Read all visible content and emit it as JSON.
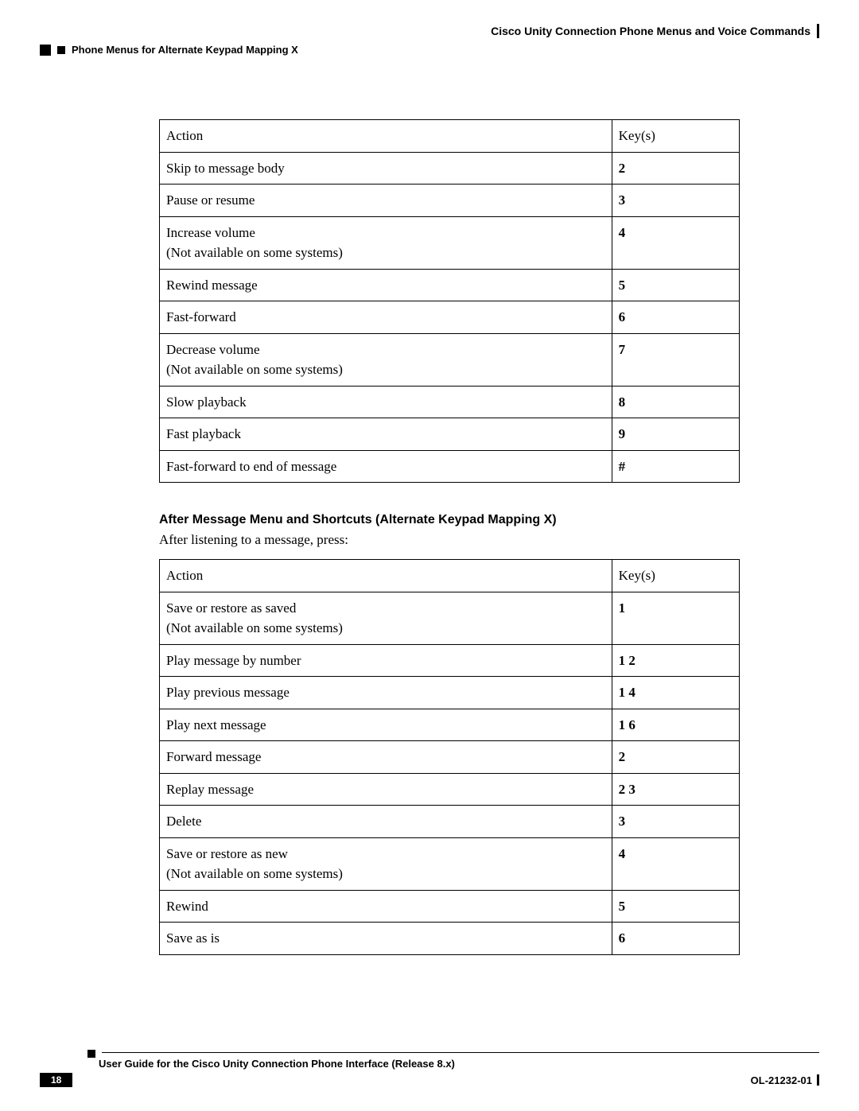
{
  "header": {
    "doc_title": "Cisco Unity Connection Phone Menus and Voice Commands",
    "section_title": "Phone Menus for Alternate Keypad Mapping X"
  },
  "table1": {
    "header": {
      "action": "Action",
      "key": "Key(s)"
    },
    "rows": [
      {
        "action": "Skip to message body",
        "note": "",
        "key": "2"
      },
      {
        "action": "Pause or resume",
        "note": "",
        "key": "3"
      },
      {
        "action": "Increase volume",
        "note": "(Not available on some systems)",
        "key": "4"
      },
      {
        "action": "Rewind message",
        "note": "",
        "key": "5"
      },
      {
        "action": "Fast-forward",
        "note": "",
        "key": "6"
      },
      {
        "action": "Decrease volume",
        "note": "(Not available on some systems)",
        "key": "7"
      },
      {
        "action": "Slow playback",
        "note": "",
        "key": "8"
      },
      {
        "action": "Fast playback",
        "note": "",
        "key": "9"
      },
      {
        "action": "Fast-forward to end of message",
        "note": "",
        "key": "#"
      }
    ]
  },
  "section2": {
    "heading": "After Message Menu and Shortcuts (Alternate Keypad Mapping X)",
    "intro": "After listening to a message, press:"
  },
  "table2": {
    "header": {
      "action": "Action",
      "key": "Key(s)"
    },
    "rows": [
      {
        "action": "Save or restore as saved",
        "note": "(Not available on some systems)",
        "key": "1"
      },
      {
        "action": "Play message by number",
        "note": "",
        "key": "1 2"
      },
      {
        "action": "Play previous message",
        "note": "",
        "key": "1 4"
      },
      {
        "action": "Play next message",
        "note": "",
        "key": "1 6"
      },
      {
        "action": "Forward message",
        "note": "",
        "key": "2"
      },
      {
        "action": "Replay message",
        "note": "",
        "key": "2 3"
      },
      {
        "action": "Delete",
        "note": "",
        "key": "3"
      },
      {
        "action": "Save or restore as new",
        "note": "(Not available on some systems)",
        "key": "4"
      },
      {
        "action": "Rewind",
        "note": "",
        "key": "5"
      },
      {
        "action": "Save as is",
        "note": "",
        "key": "6"
      }
    ]
  },
  "footer": {
    "guide_title": "User Guide for the Cisco Unity Connection Phone Interface (Release 8.x)",
    "page_number": "18",
    "doc_id": "OL-21232-01"
  }
}
